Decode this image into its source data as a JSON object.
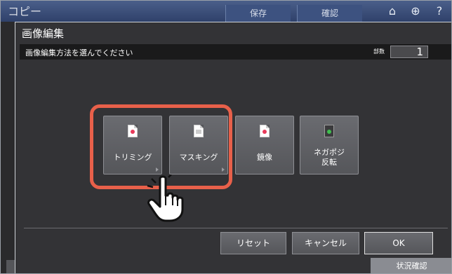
{
  "app": {
    "title": "コピー"
  },
  "topbar": {
    "tab_save": "保存",
    "tab_confirm": "確認"
  },
  "dialog": {
    "title": "画像編集",
    "instruction": "画像編集方法を選んでください",
    "copies_label": "部数",
    "copies_value": "1"
  },
  "functions": [
    {
      "label": "トリミング",
      "icon": "trimming-icon",
      "accent": "#e83a5a"
    },
    {
      "label": "マスキング",
      "icon": "masking-icon",
      "accent": "#cccccc"
    },
    {
      "label": "鏡像",
      "icon": "mirror-icon",
      "accent": "#e83a5a"
    },
    {
      "label_line1": "ネガポジ",
      "label_line2": "反転",
      "icon": "negapos-icon",
      "accent": "#3fbf4f"
    }
  ],
  "buttons": {
    "reset": "リセット",
    "cancel": "キャンセル",
    "ok": "OK"
  },
  "status": {
    "label": "状況確認"
  },
  "colors": {
    "highlight": "#e8604a",
    "topbar": "#3d5280"
  }
}
